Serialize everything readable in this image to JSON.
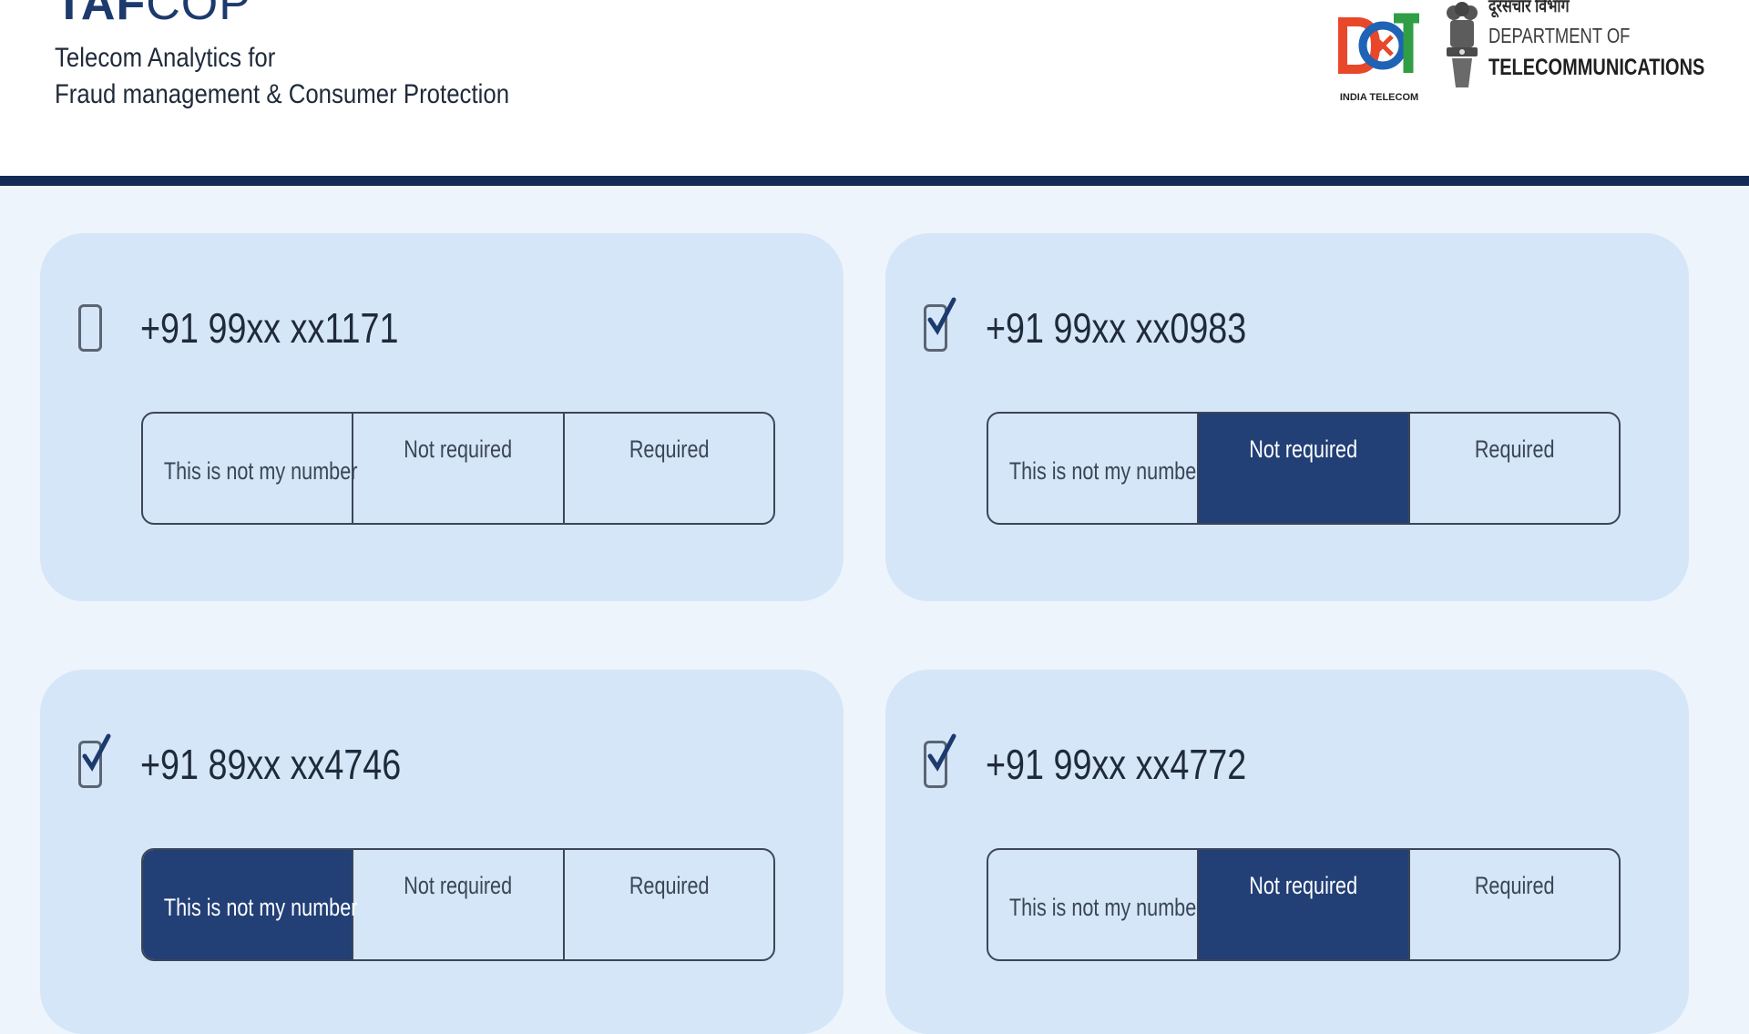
{
  "header": {
    "brand_bold": "TAF",
    "brand_light": "COP",
    "subtitle_line1": "Telecom Analytics for",
    "subtitle_line2": "Fraud management & Consumer Protection",
    "dot_caption": "INDIA TELECOM",
    "dept_hindi": "दूरसंचार विभाग",
    "dept_line1": "DEPARTMENT OF",
    "dept_line2": "TELECOMMUNICATIONS"
  },
  "colors": {
    "accent": "#223f76",
    "card_bg": "#d5e6f8",
    "page_bg": "#eef4fb",
    "rule": "#142b58"
  },
  "options": {
    "not_my_number": "This is not my number",
    "not_required": "Not required",
    "required": "Required"
  },
  "numbers": [
    {
      "number": "+91 99xx xx1171",
      "checked": false,
      "selected": ""
    },
    {
      "number": "+91 99xx xx0983",
      "checked": true,
      "selected": "Not required"
    },
    {
      "number": "+91 89xx xx4746",
      "checked": true,
      "selected": "This is not my number"
    },
    {
      "number": "+91 99xx xx4772",
      "checked": true,
      "selected": "Not required"
    }
  ]
}
